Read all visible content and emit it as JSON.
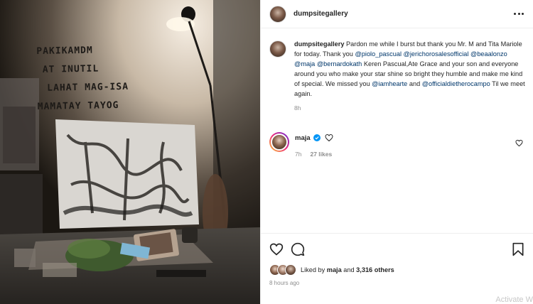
{
  "header": {
    "username": "dumpsitegallery"
  },
  "caption": {
    "username": "dumpsitegallery",
    "text_1": " Pardon me while I burst but thank you Mr. M and Tita Mariole for today. Thank you ",
    "mention_1": "@piolo_pascual",
    "mention_2": "@jerichorosalesofficial",
    "mention_3": "@beaalonzo",
    "mention_4": "@maja",
    "mention_5": "@bernardokath",
    "text_2": " Keren Pascual,Ate Grace and your son and everyone around you who make your star shine so bright they humble and make me kind of special. We missed you ",
    "mention_6": "@iamhearte",
    "text_3": " and ",
    "mention_7": "@officialdietherocampo",
    "text_4": " Til we meet again.",
    "time": "8h"
  },
  "comment": {
    "username": "maja",
    "time": "7h",
    "likes": "27 likes"
  },
  "likes": {
    "prefix": "Liked by ",
    "user": "maja",
    "middle": " and ",
    "count": "3,316 others"
  },
  "post_time": "8 hours ago",
  "watermark": "Activate W",
  "photo": {
    "wall_text_1": "PAKIKAMDM",
    "wall_text_2": "AT INUTIL",
    "wall_text_3": "LAHAT MAG-ISA",
    "wall_text_4": "MAMATAY TAYOG"
  },
  "icons": {
    "more": "more-horizontal-icon",
    "verified": "verified-badge-icon",
    "heart": "heart-icon",
    "comment": "comment-bubble-icon",
    "save": "bookmark-icon"
  },
  "colors": {
    "link": "#00376b",
    "verified": "#0095f6",
    "muted": "#8e8e8e"
  }
}
